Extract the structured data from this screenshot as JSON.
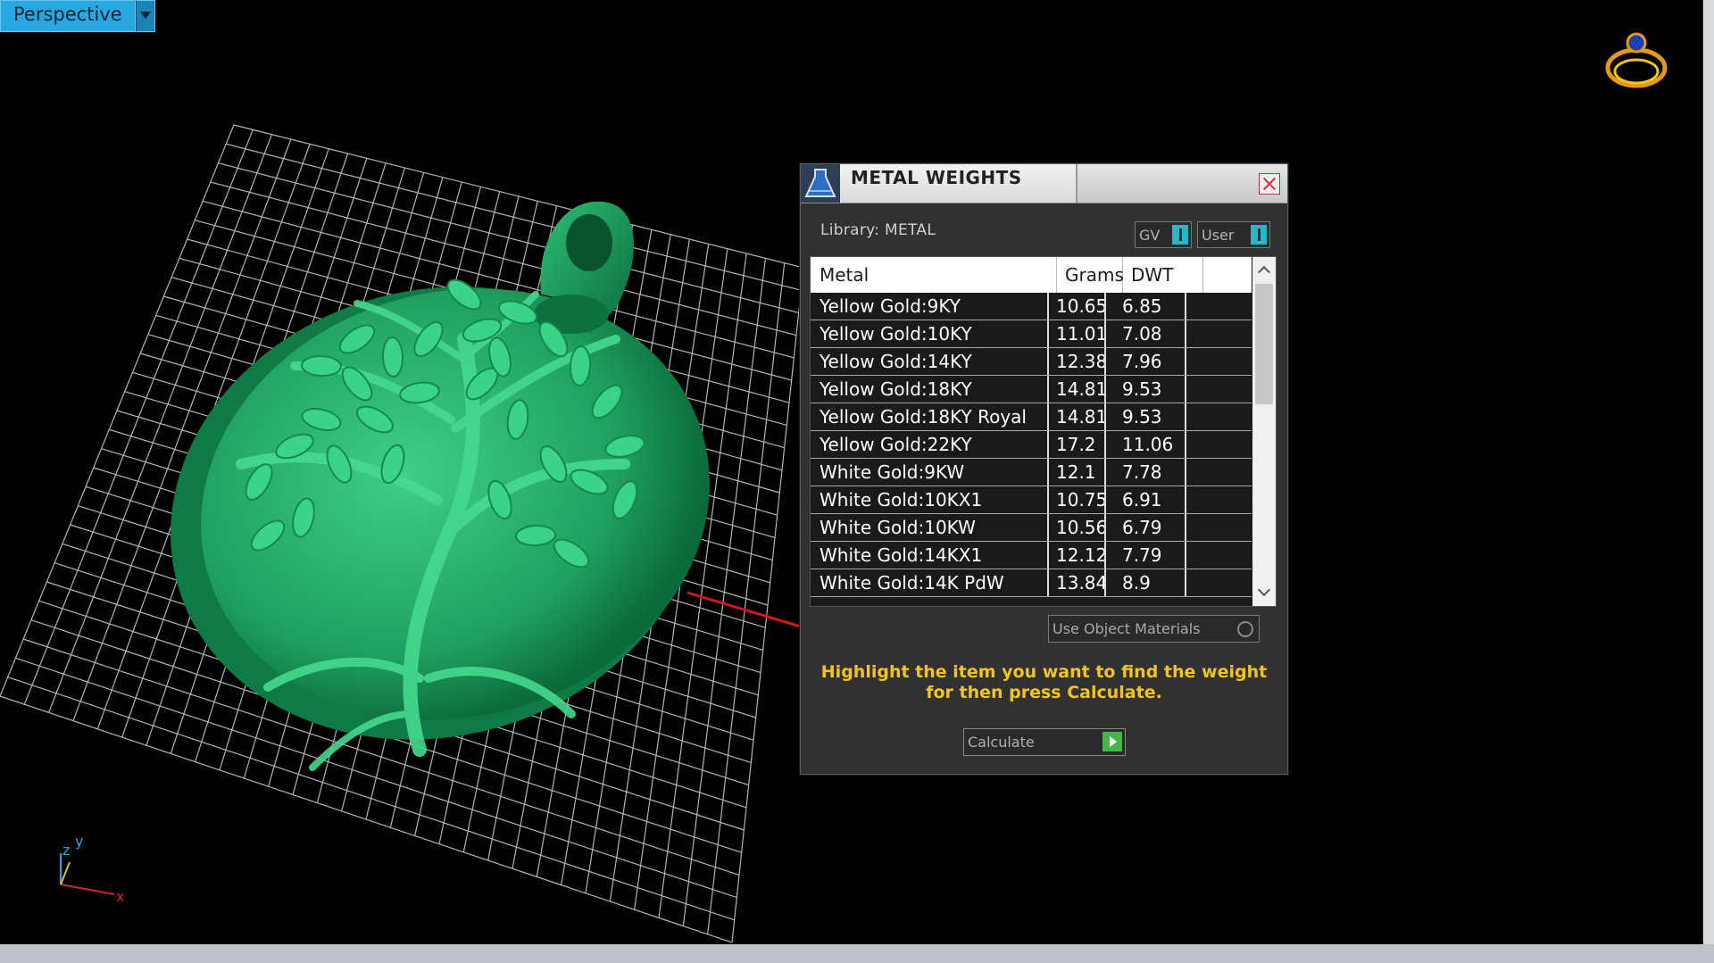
{
  "viewport": {
    "view_name": "Perspective"
  },
  "panel": {
    "title": "METAL WEIGHTS",
    "library_label": "Library: METAL",
    "btn_gv": "GV",
    "btn_user": "User",
    "columns": [
      "Metal",
      "Grams",
      "DWT"
    ],
    "rows": [
      [
        "Yellow Gold:9KY",
        "10.65",
        "6.85"
      ],
      [
        "Yellow Gold:10KY",
        "11.01",
        "7.08"
      ],
      [
        "Yellow Gold:14KY",
        "12.38",
        "7.96"
      ],
      [
        "Yellow Gold:18KY",
        "14.81",
        "9.53"
      ],
      [
        "Yellow Gold:18KY Royal",
        "14.81",
        "9.53"
      ],
      [
        "Yellow Gold:22KY",
        "17.2",
        "11.06"
      ],
      [
        "White Gold:9KW",
        "12.1",
        "7.78"
      ],
      [
        "White Gold:10KX1",
        "10.75",
        "6.91"
      ],
      [
        "White Gold:10KW",
        "10.56",
        "6.79"
      ],
      [
        "White Gold:14KX1",
        "12.12",
        "7.79"
      ],
      [
        "White Gold:14K PdW",
        "13.84",
        "8.9"
      ]
    ],
    "use_object_materials": "Use Object Materials",
    "hint_line1": "Highlight the item you want to find the weight",
    "hint_line2": "for then press Calculate.",
    "calculate_label": "Calculate"
  },
  "axis": {
    "y": "y",
    "z": "z",
    "x": "x"
  },
  "colors": {
    "model": "#1fa060",
    "accent": "#29a8df",
    "hint": "#f2c41c"
  }
}
